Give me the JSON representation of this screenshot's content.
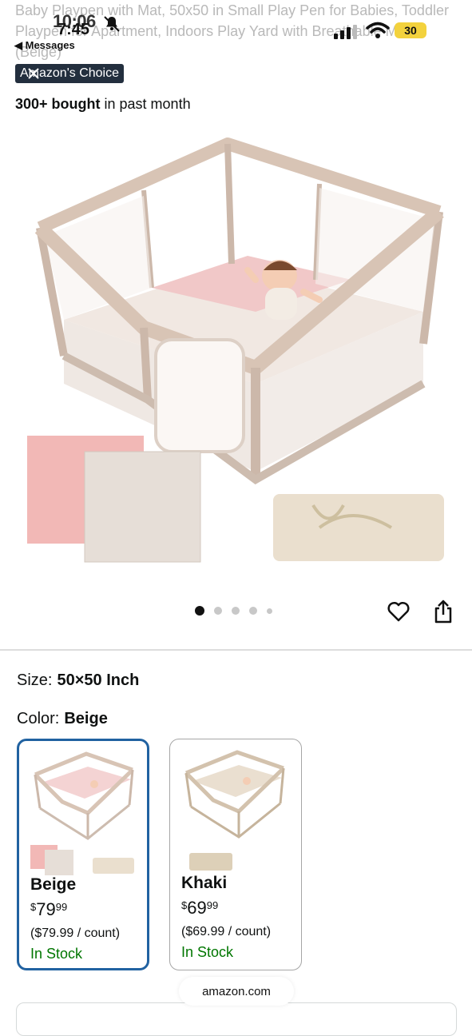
{
  "status": {
    "time_ghost": "10:06",
    "time": "7:45",
    "back_app": "◀ Messages",
    "battery": "30"
  },
  "product": {
    "title_faded": "Baby Playpen with Mat, 50x50 in Small Play Pen for Babies, Toddler Playpen for Apartment, Indoors Play Yard with Breathable Mesh (Beige)",
    "badge": "Amazon's Choice",
    "bought_bold": "300+ bought",
    "bought_rest": " in past month"
  },
  "carousel": {
    "count": 5,
    "active_index": 0
  },
  "variations": {
    "size_label": "Size:",
    "size_value": "50×50 Inch",
    "color_label": "Color:",
    "color_value": "Beige",
    "options": [
      {
        "name": "Beige",
        "price_symbol": "$",
        "price_whole": "79",
        "price_fraction": "99",
        "per_count": "($79.99 / count)",
        "availability": "In Stock",
        "selected": true
      },
      {
        "name": "Khaki",
        "price_symbol": "$",
        "price_whole": "69",
        "price_fraction": "99",
        "per_count": "($69.99 / count)",
        "availability": "In Stock",
        "selected": false
      }
    ]
  },
  "browser": {
    "domain": "amazon.com"
  },
  "colors": {
    "badge_bg": "#232F3E",
    "selected_border": "#2162A1",
    "in_stock": "#007600",
    "battery": "#f3d23d"
  },
  "icons": [
    "notification-bell-icon",
    "cellular-signal-icon",
    "wifi-icon",
    "battery-icon",
    "heart-icon",
    "share-icon"
  ]
}
